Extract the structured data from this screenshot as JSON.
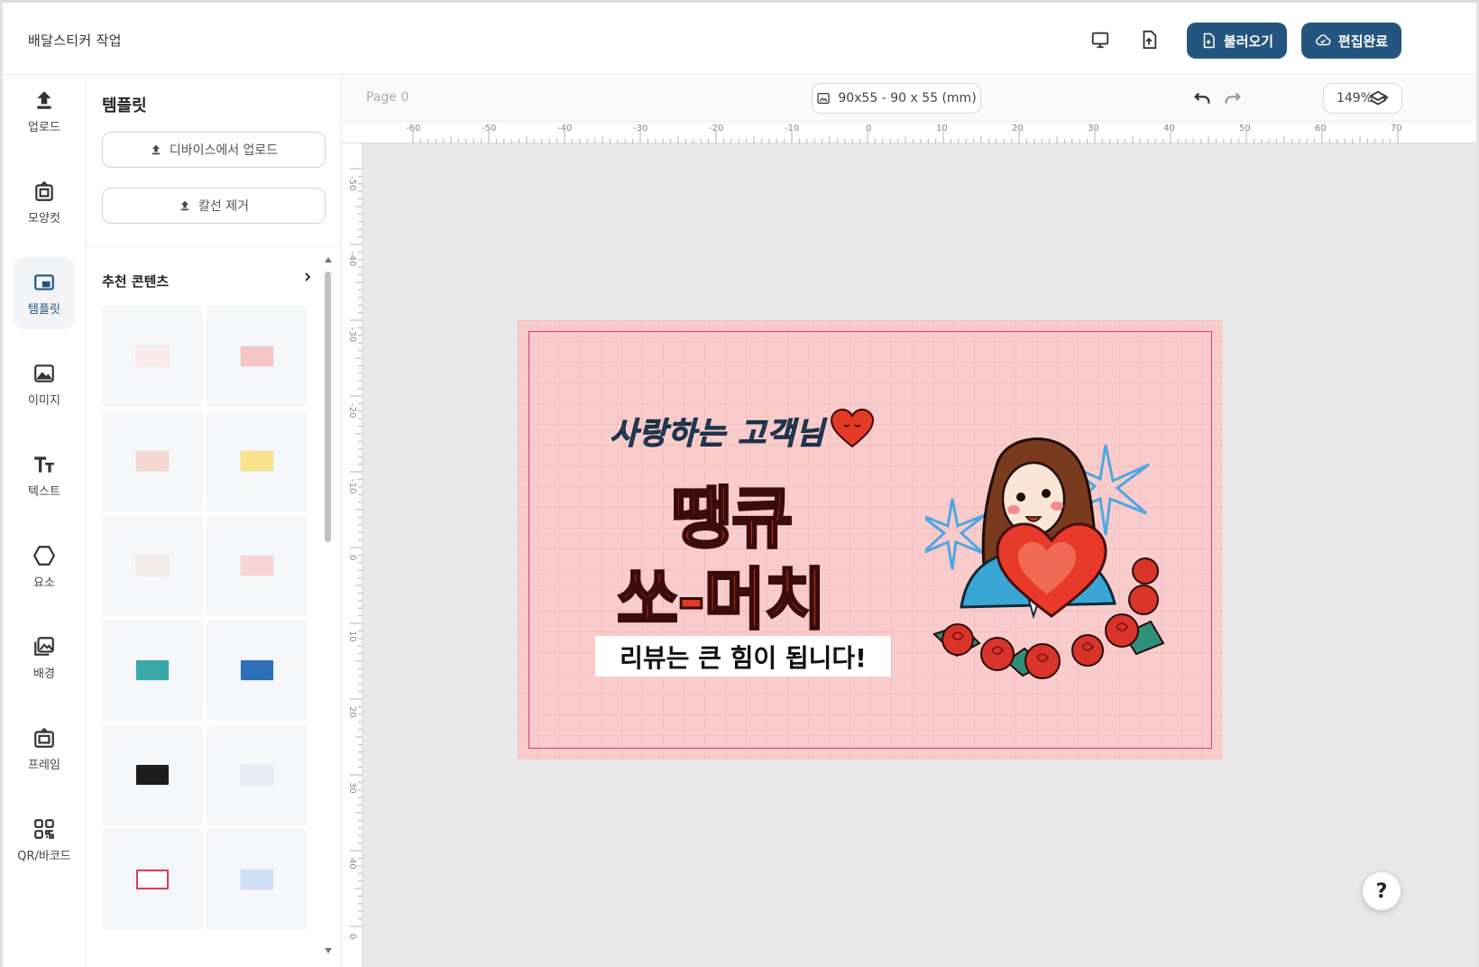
{
  "header": {
    "title": "배달스티커  작업",
    "load_label": "불러오기",
    "finish_label": "편집완료"
  },
  "rail": [
    {
      "label": "업로드",
      "icon": "upload-icon"
    },
    {
      "label": "모양컷",
      "icon": "shape-cut-icon"
    },
    {
      "label": "템플릿",
      "icon": "template-icon",
      "active": true
    },
    {
      "label": "이미지",
      "icon": "image-icon"
    },
    {
      "label": "텍스트",
      "icon": "text-icon"
    },
    {
      "label": "요소",
      "icon": "hexagon-icon"
    },
    {
      "label": "배경",
      "icon": "background-icon"
    },
    {
      "label": "프레임",
      "icon": "frame-icon"
    },
    {
      "label": "QR/바코드",
      "icon": "qr-icon"
    }
  ],
  "panel": {
    "title": "템플릿",
    "upload_device": "디바이스에서 업로드",
    "remove_cutline": "칼선 제거",
    "section_title": "추천 콘텐츠"
  },
  "toolbar": {
    "page": "Page 0",
    "size": "90x55 - 90 x 55 (mm)",
    "zoom": "149%"
  },
  "ruler": {
    "h_ticks": [
      "-60",
      "-50",
      "-40",
      "-30",
      "-20",
      "-10",
      "0",
      "10",
      "20",
      "30",
      "40",
      "50",
      "60",
      "70"
    ],
    "v_ticks": [
      "-50",
      "-40",
      "-30",
      "-20",
      "-10",
      "0",
      "10",
      "20",
      "30",
      "40",
      "0"
    ]
  },
  "design": {
    "line1": "사랑하는 고객님",
    "line2": "땡큐",
    "line3": "쏘-머치",
    "review": "리뷰는 큰 힘이 됩니다!"
  },
  "colors": {
    "primary": "#24557f",
    "artboard": "#f9cccc",
    "safe_line": "#e8347a",
    "headline": "#e23a26"
  },
  "help": "?"
}
